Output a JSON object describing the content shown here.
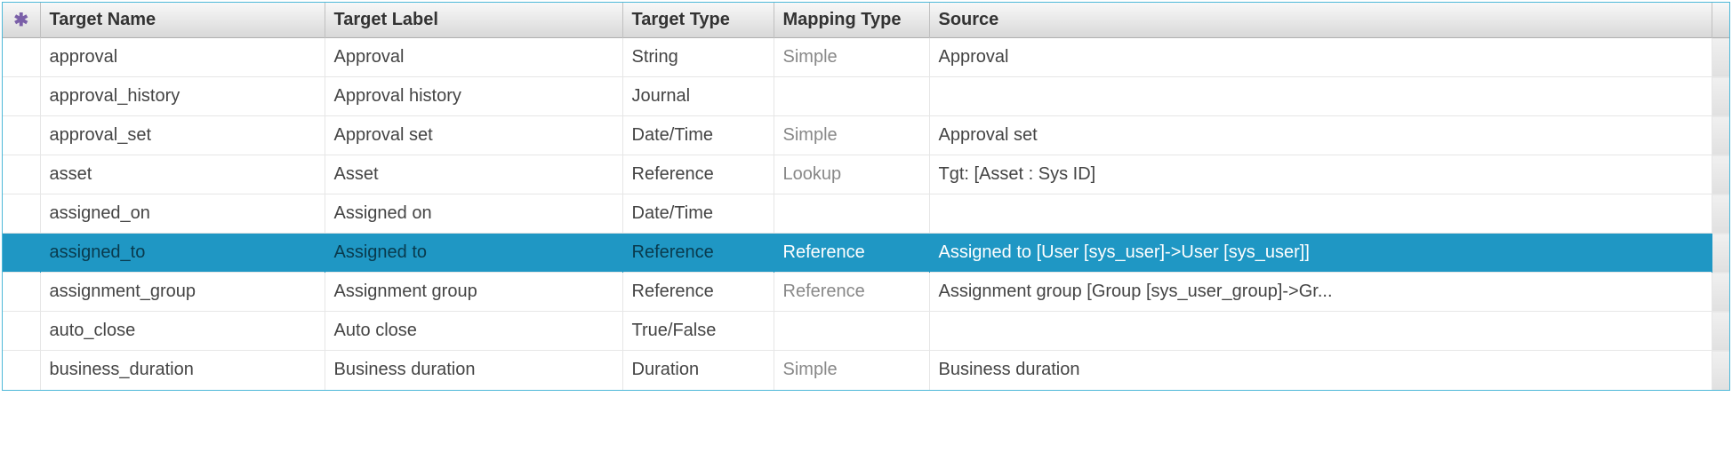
{
  "columns": {
    "targetName": "Target Name",
    "targetLabel": "Target Label",
    "targetType": "Target Type",
    "mappingType": "Mapping Type",
    "source": "Source"
  },
  "selectedIndex": 5,
  "rows": [
    {
      "targetName": "approval",
      "targetLabel": "Approval",
      "targetType": "String",
      "mappingType": "Simple",
      "source": "Approval"
    },
    {
      "targetName": "approval_history",
      "targetLabel": "Approval history",
      "targetType": "Journal",
      "mappingType": "",
      "source": ""
    },
    {
      "targetName": "approval_set",
      "targetLabel": "Approval set",
      "targetType": "Date/Time",
      "mappingType": "Simple",
      "source": "Approval set"
    },
    {
      "targetName": "asset",
      "targetLabel": "Asset",
      "targetType": "Reference",
      "mappingType": "Lookup",
      "source": "Tgt: [Asset : Sys ID]"
    },
    {
      "targetName": "assigned_on",
      "targetLabel": "Assigned on",
      "targetType": "Date/Time",
      "mappingType": "",
      "source": ""
    },
    {
      "targetName": "assigned_to",
      "targetLabel": "Assigned to",
      "targetType": "Reference",
      "mappingType": "Reference",
      "source": "Assigned to [User [sys_user]->User [sys_user]]"
    },
    {
      "targetName": "assignment_group",
      "targetLabel": "Assignment group",
      "targetType": "Reference",
      "mappingType": "Reference",
      "source": "Assignment group [Group [sys_user_group]->Gr..."
    },
    {
      "targetName": "auto_close",
      "targetLabel": "Auto close",
      "targetType": "True/False",
      "mappingType": "",
      "source": ""
    },
    {
      "targetName": "business_duration",
      "targetLabel": "Business duration",
      "targetType": "Duration",
      "mappingType": "Simple",
      "source": "Business duration"
    }
  ]
}
